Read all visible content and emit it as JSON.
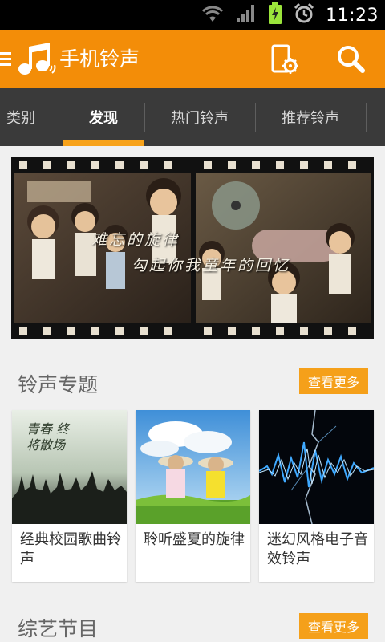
{
  "status_bar": {
    "time": "11:23",
    "icons": [
      "wifi-icon",
      "signal-icon",
      "battery-charging-icon",
      "alarm-icon"
    ]
  },
  "action_bar": {
    "title": "手机铃声",
    "icons": [
      "menu-icon",
      "music-note-logo-icon",
      "phone-settings-icon",
      "search-icon"
    ]
  },
  "tabs": [
    {
      "label": "类别",
      "active": false
    },
    {
      "label": "发现",
      "active": true
    },
    {
      "label": "热门铃声",
      "active": false
    },
    {
      "label": "推荐铃声",
      "active": false
    }
  ],
  "banner": {
    "caption_line1": "难忘的旋律",
    "caption_line2": "勾起你我童年的回忆"
  },
  "sections": [
    {
      "title": "铃声专题",
      "more_label": "查看更多",
      "cards": [
        {
          "label": "经典校园歌曲铃声",
          "image_text": "青春 终将散场"
        },
        {
          "label": "聆听盛夏的旋律"
        },
        {
          "label": "迷幻风格电子音效铃声"
        }
      ]
    },
    {
      "title": "综艺节目",
      "more_label": "查看更多"
    }
  ],
  "colors": {
    "accent_orange": "#f38d08",
    "tab_indicator": "#f7a21a",
    "more_button": "#f5a01a",
    "tab_bar": "#3a3a3a"
  }
}
